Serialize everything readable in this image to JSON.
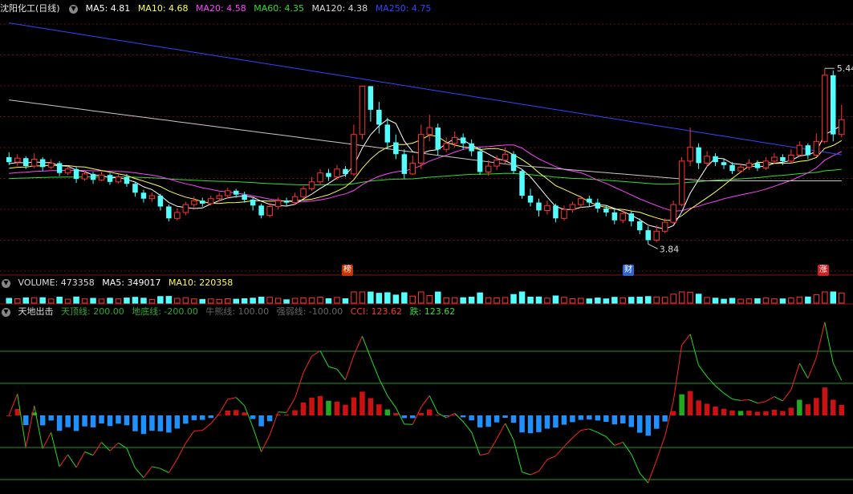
{
  "main_panel": {
    "title": "沈阳化工(日线)",
    "ma": [
      {
        "label": "MA5: 4.81",
        "color": "#ffffff"
      },
      {
        "label": "MA10: 4.68",
        "color": "#ffff55"
      },
      {
        "label": "MA20: 4.58",
        "color": "#ff44ff"
      },
      {
        "label": "MA60: 4.35",
        "color": "#33dd33"
      },
      {
        "label": "MA120: 4.38",
        "color": "#dddddd"
      },
      {
        "label": "MA250: 4.75",
        "color": "#3344ff"
      }
    ],
    "high_label": "5.44",
    "low_label": "3.84",
    "markers": [
      {
        "text": "榜",
        "color": "#cc3300"
      },
      {
        "text": "财",
        "color": "#3366cc"
      },
      {
        "text": "涨",
        "color": "#cc2222"
      }
    ]
  },
  "volume_panel": {
    "volume": "VOLUME: 473358",
    "ma5": "MA5: 349017",
    "ma10": "MA10: 220358"
  },
  "indicator_panel": {
    "name": "天地出击",
    "lines": [
      {
        "label": "天顶线: 200.00",
        "color": "#2eaa2e"
      },
      {
        "label": "地底线: -200.00",
        "color": "#2eaa2e"
      },
      {
        "label": "牛熊线: 100.00",
        "color": "#666666"
      },
      {
        "label": "强弱线: -100.00",
        "color": "#666666"
      },
      {
        "label": "CCI: 123.62",
        "color": "#ff3333"
      },
      {
        "label": "跌: 123.62",
        "color": "#33dd33"
      }
    ]
  },
  "chart_data": {
    "type": "candlestick",
    "price_range": [
      3.55,
      6.15
    ],
    "candles": [
      [
        4.72,
        4.67,
        4.77,
        4.64
      ],
      [
        4.67,
        4.71,
        4.75,
        4.63
      ],
      [
        4.71,
        4.63,
        4.73,
        4.6
      ],
      [
        4.63,
        4.7,
        4.76,
        4.61
      ],
      [
        4.7,
        4.62,
        4.72,
        4.58
      ],
      [
        4.62,
        4.66,
        4.7,
        4.6
      ],
      [
        4.66,
        4.56,
        4.68,
        4.53
      ],
      [
        4.56,
        4.6,
        4.63,
        4.54
      ],
      [
        4.6,
        4.5,
        4.62,
        4.46
      ],
      [
        4.5,
        4.55,
        4.58,
        4.48
      ],
      [
        4.55,
        4.49,
        4.57,
        4.45
      ],
      [
        4.49,
        4.54,
        4.57,
        4.48
      ],
      [
        4.54,
        4.47,
        4.56,
        4.44
      ],
      [
        4.47,
        4.52,
        4.55,
        4.45
      ],
      [
        4.52,
        4.45,
        4.55,
        4.42
      ],
      [
        4.45,
        4.36,
        4.47,
        4.32
      ],
      [
        4.36,
        4.3,
        4.39,
        4.26
      ],
      [
        4.3,
        4.33,
        4.36,
        4.27
      ],
      [
        4.33,
        4.22,
        4.35,
        4.18
      ],
      [
        4.22,
        4.1,
        4.24,
        4.07
      ],
      [
        4.1,
        4.16,
        4.2,
        4.08
      ],
      [
        4.16,
        4.24,
        4.27,
        4.13
      ],
      [
        4.24,
        4.28,
        4.32,
        4.21
      ],
      [
        4.28,
        4.25,
        4.31,
        4.22
      ],
      [
        4.25,
        4.3,
        4.33,
        4.23
      ],
      [
        4.3,
        4.33,
        4.36,
        4.27
      ],
      [
        4.33,
        4.38,
        4.41,
        4.3
      ],
      [
        4.38,
        4.34,
        4.4,
        4.31
      ],
      [
        4.34,
        4.29,
        4.37,
        4.26
      ],
      [
        4.29,
        4.23,
        4.31,
        4.18
      ],
      [
        4.23,
        4.13,
        4.25,
        4.1
      ],
      [
        4.13,
        4.22,
        4.26,
        4.11
      ],
      [
        4.22,
        4.28,
        4.31,
        4.19
      ],
      [
        4.28,
        4.26,
        4.31,
        4.23
      ],
      [
        4.26,
        4.32,
        4.36,
        4.24
      ],
      [
        4.32,
        4.4,
        4.43,
        4.3
      ],
      [
        4.4,
        4.47,
        4.52,
        4.38
      ],
      [
        4.47,
        4.56,
        4.6,
        4.44
      ],
      [
        4.56,
        4.52,
        4.6,
        4.48
      ],
      [
        4.52,
        4.6,
        4.64,
        4.49
      ],
      [
        4.6,
        4.55,
        4.63,
        4.52
      ],
      [
        4.55,
        4.95,
        5.05,
        4.53
      ],
      [
        4.95,
        5.44,
        5.44,
        4.9
      ],
      [
        5.44,
        5.2,
        5.38,
        5.08
      ],
      [
        5.2,
        5.05,
        5.28,
        4.96
      ],
      [
        5.05,
        4.87,
        5.12,
        4.8
      ],
      [
        4.87,
        4.75,
        4.95,
        4.7
      ],
      [
        4.75,
        4.55,
        4.8,
        4.5
      ],
      [
        4.55,
        4.66,
        4.74,
        4.54
      ],
      [
        4.66,
        4.95,
        5.05,
        4.6
      ],
      [
        4.95,
        5.02,
        5.15,
        4.88
      ],
      [
        5.02,
        4.8,
        5.06,
        4.74
      ],
      [
        4.8,
        4.86,
        4.92,
        4.77
      ],
      [
        4.86,
        4.92,
        4.98,
        4.82
      ],
      [
        4.92,
        4.86,
        4.96,
        4.8
      ],
      [
        4.86,
        4.78,
        4.9,
        4.73
      ],
      [
        4.78,
        4.57,
        4.82,
        4.54
      ],
      [
        4.57,
        4.63,
        4.69,
        4.53
      ],
      [
        4.63,
        4.69,
        4.74,
        4.59
      ],
      [
        4.69,
        4.75,
        4.82,
        4.65
      ],
      [
        4.75,
        4.58,
        4.78,
        4.55
      ],
      [
        4.58,
        4.33,
        4.6,
        4.3
      ],
      [
        4.33,
        4.26,
        4.4,
        4.22
      ],
      [
        4.26,
        4.18,
        4.3,
        4.12
      ],
      [
        4.18,
        4.23,
        4.28,
        4.14
      ],
      [
        4.23,
        4.1,
        4.25,
        4.06
      ],
      [
        4.1,
        4.19,
        4.23,
        4.08
      ],
      [
        4.19,
        4.24,
        4.27,
        4.16
      ],
      [
        4.24,
        4.3,
        4.33,
        4.21
      ],
      [
        4.3,
        4.26,
        4.33,
        4.22
      ],
      [
        4.26,
        4.2,
        4.3,
        4.16
      ],
      [
        4.2,
        4.16,
        4.23,
        4.12
      ],
      [
        4.16,
        4.08,
        4.2,
        4.04
      ],
      [
        4.08,
        4.15,
        4.19,
        4.05
      ],
      [
        4.15,
        4.07,
        4.18,
        4.02
      ],
      [
        4.07,
        3.98,
        4.1,
        3.94
      ],
      [
        3.98,
        3.88,
        4.02,
        3.84
      ],
      [
        3.88,
        3.97,
        4.03,
        3.86
      ],
      [
        3.97,
        4.06,
        4.1,
        3.95
      ],
      [
        4.06,
        4.24,
        4.28,
        4.04
      ],
      [
        4.24,
        4.68,
        4.72,
        4.22
      ],
      [
        4.68,
        4.82,
        5.02,
        4.63
      ],
      [
        4.82,
        4.66,
        4.86,
        4.6
      ],
      [
        4.66,
        4.73,
        4.78,
        4.62
      ],
      [
        4.73,
        4.67,
        4.76,
        4.63
      ],
      [
        4.67,
        4.64,
        4.7,
        4.6
      ],
      [
        4.64,
        4.58,
        4.67,
        4.55
      ],
      [
        4.58,
        4.62,
        4.65,
        4.56
      ],
      [
        4.62,
        4.66,
        4.7,
        4.59
      ],
      [
        4.66,
        4.61,
        4.69,
        4.58
      ],
      [
        4.61,
        4.68,
        4.72,
        4.59
      ],
      [
        4.68,
        4.72,
        4.76,
        4.65
      ],
      [
        4.72,
        4.68,
        4.75,
        4.64
      ],
      [
        4.68,
        4.74,
        4.8,
        4.66
      ],
      [
        4.74,
        4.84,
        4.88,
        4.72
      ],
      [
        4.84,
        4.74,
        4.86,
        4.7
      ],
      [
        4.74,
        4.88,
        4.96,
        4.72
      ],
      [
        4.88,
        5.55,
        5.62,
        4.86
      ],
      [
        5.55,
        4.95,
        5.6,
        4.88
      ],
      [
        4.95,
        5.1,
        5.25,
        4.92
      ]
    ]
  }
}
